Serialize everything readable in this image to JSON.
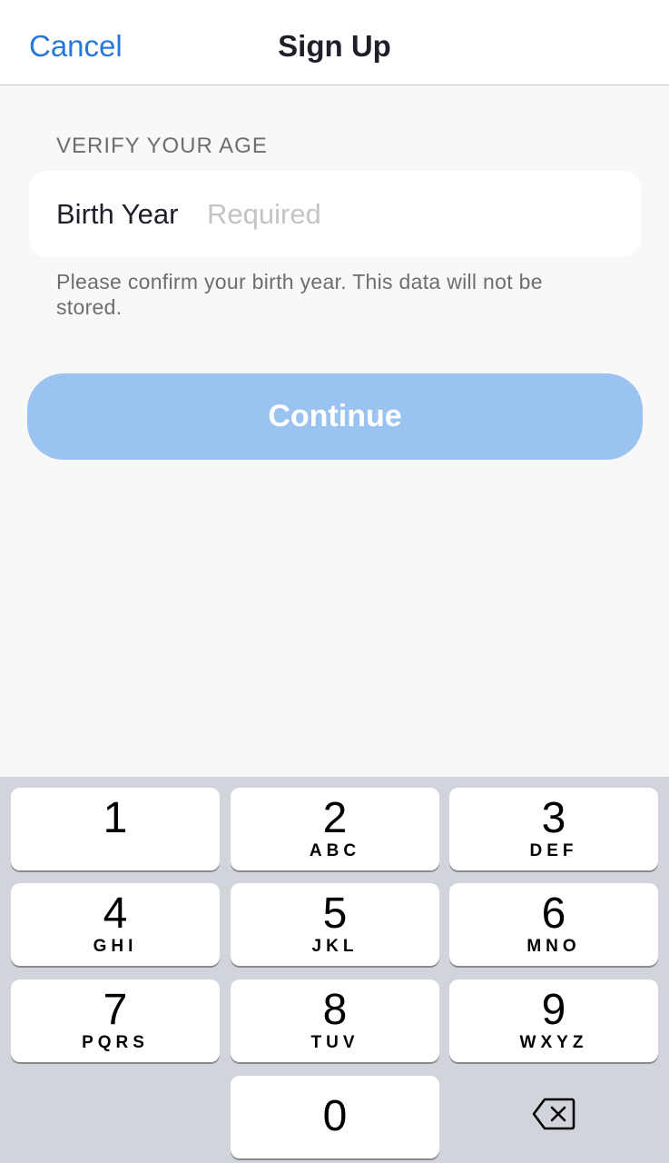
{
  "navbar": {
    "cancel_label": "Cancel",
    "title": "Sign Up"
  },
  "section": {
    "header": "VERIFY YOUR AGE",
    "field_label": "Birth Year",
    "field_placeholder": "Required",
    "field_value": "",
    "footnote": "Please confirm your birth year. This data will not be stored."
  },
  "continue_button": {
    "label": "Continue",
    "enabled": false,
    "color": "#9ac3f2"
  },
  "keyboard": {
    "keys": [
      {
        "digit": "1",
        "letters": ""
      },
      {
        "digit": "2",
        "letters": "ABC"
      },
      {
        "digit": "3",
        "letters": "DEF"
      },
      {
        "digit": "4",
        "letters": "GHI"
      },
      {
        "digit": "5",
        "letters": "JKL"
      },
      {
        "digit": "6",
        "letters": "MNO"
      },
      {
        "digit": "7",
        "letters": "PQRS"
      },
      {
        "digit": "8",
        "letters": "TUV"
      },
      {
        "digit": "9",
        "letters": "WXYZ"
      },
      {
        "digit": "0",
        "letters": ""
      }
    ],
    "backspace_icon": "backspace-icon"
  },
  "colors": {
    "accent": "#2878d8",
    "keyboard_bg": "#d2d4db"
  }
}
